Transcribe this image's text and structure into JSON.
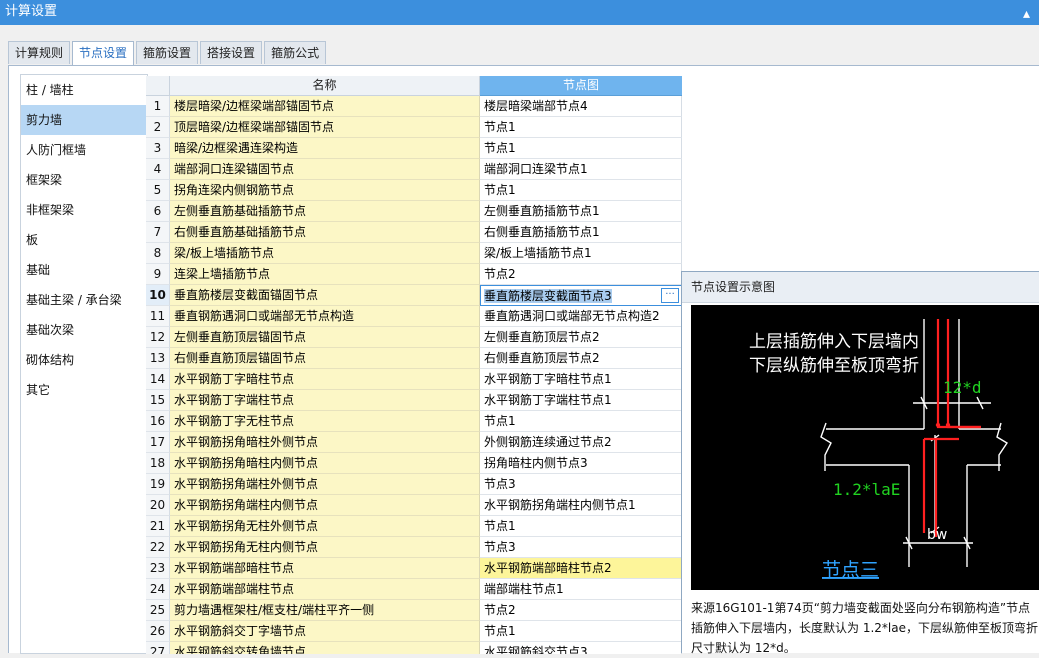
{
  "window": {
    "title": "计算设置"
  },
  "tabs": [
    {
      "label": "计算规则"
    },
    {
      "label": "节点设置"
    },
    {
      "label": "箍筋设置"
    },
    {
      "label": "搭接设置"
    },
    {
      "label": "箍筋公式"
    }
  ],
  "sidebar": {
    "items": [
      {
        "label": "柱 / 墙柱"
      },
      {
        "label": "剪力墙"
      },
      {
        "label": "人防门框墙"
      },
      {
        "label": "框架梁"
      },
      {
        "label": "非框架梁"
      },
      {
        "label": "板"
      },
      {
        "label": "基础"
      },
      {
        "label": "基础主梁 / 承台梁"
      },
      {
        "label": "基础次梁"
      },
      {
        "label": "砌体结构"
      },
      {
        "label": "其它"
      }
    ]
  },
  "grid": {
    "headers": {
      "name": "名称",
      "node": "节点图"
    },
    "rows": [
      {
        "num": "1",
        "name": "楼层暗梁/边框梁端部锚固节点",
        "node": "楼层暗梁端部节点4"
      },
      {
        "num": "2",
        "name": "顶层暗梁/边框梁端部锚固节点",
        "node": "节点1"
      },
      {
        "num": "3",
        "name": "暗梁/边框梁遇连梁构造",
        "node": "节点1"
      },
      {
        "num": "4",
        "name": "端部洞口连梁锚固节点",
        "node": "端部洞口连梁节点1"
      },
      {
        "num": "5",
        "name": "拐角连梁内侧钢筋节点",
        "node": "节点1"
      },
      {
        "num": "6",
        "name": "左侧垂直筋基础插筋节点",
        "node": "左侧垂直筋插筋节点1"
      },
      {
        "num": "7",
        "name": "右侧垂直筋基础插筋节点",
        "node": "右侧垂直筋插筋节点1"
      },
      {
        "num": "8",
        "name": "梁/板上墙插筋节点",
        "node": "梁/板上墙插筋节点1"
      },
      {
        "num": "9",
        "name": "连梁上墙插筋节点",
        "node": "节点2"
      },
      {
        "num": "10",
        "name": "垂直筋楼层变截面锚固节点",
        "node": "垂直筋楼层变截面节点3"
      },
      {
        "num": "11",
        "name": "垂直钢筋遇洞口或端部无节点构造",
        "node": "垂直筋遇洞口或端部无节点构造2"
      },
      {
        "num": "12",
        "name": "左侧垂直筋顶层锚固节点",
        "node": "左侧垂直筋顶层节点2"
      },
      {
        "num": "13",
        "name": "右侧垂直筋顶层锚固节点",
        "node": "右侧垂直筋顶层节点2"
      },
      {
        "num": "14",
        "name": "水平钢筋丁字暗柱节点",
        "node": "水平钢筋丁字暗柱节点1"
      },
      {
        "num": "15",
        "name": "水平钢筋丁字端柱节点",
        "node": "水平钢筋丁字端柱节点1"
      },
      {
        "num": "16",
        "name": "水平钢筋丁字无柱节点",
        "node": "节点1"
      },
      {
        "num": "17",
        "name": "水平钢筋拐角暗柱外侧节点",
        "node": "外侧钢筋连续通过节点2"
      },
      {
        "num": "18",
        "name": "水平钢筋拐角暗柱内侧节点",
        "node": "拐角暗柱内侧节点3"
      },
      {
        "num": "19",
        "name": "水平钢筋拐角端柱外侧节点",
        "node": "节点3"
      },
      {
        "num": "20",
        "name": "水平钢筋拐角端柱内侧节点",
        "node": "水平钢筋拐角端柱内侧节点1"
      },
      {
        "num": "21",
        "name": "水平钢筋拐角无柱外侧节点",
        "node": "节点1"
      },
      {
        "num": "22",
        "name": "水平钢筋拐角无柱内侧节点",
        "node": "节点3"
      },
      {
        "num": "23",
        "name": "水平钢筋端部暗柱节点",
        "node": "水平钢筋端部暗柱节点2"
      },
      {
        "num": "24",
        "name": "水平钢筋端部端柱节点",
        "node": "端部端柱节点1"
      },
      {
        "num": "25",
        "name": "剪力墙遇框架柱/框支柱/端柱平齐一侧",
        "node": "节点2"
      },
      {
        "num": "26",
        "name": "水平钢筋斜交丁字墙节点",
        "node": "节点1"
      },
      {
        "num": "27",
        "name": "水平钢筋斜交转角墙节点",
        "node": "水平钢筋斜交节点3"
      }
    ]
  },
  "preview": {
    "title": "节点设置示意图",
    "diagram": {
      "line1": "上层插筋伸入下层墙内",
      "line2": "下层纵筋伸至板顶弯折",
      "dim_top": "12*d",
      "dim_left": "1.2*laE",
      "dim_bottom": "bw",
      "caption": "节点三"
    },
    "desc": [
      "来源16G101-1第74页“剪力墙变截面处竖向分布钢筋构造”节点",
      "插筋伸入下层墙内，长度默认为 1.2*lae，下层纵筋伸至板顶弯折，",
      "尺寸默认为 12*d。"
    ]
  },
  "colors": {
    "accent": "#3c8fdd",
    "name_cell": "#fcf7c6",
    "highlight": "#fdf59a",
    "header_active": "#6fb4ee"
  }
}
